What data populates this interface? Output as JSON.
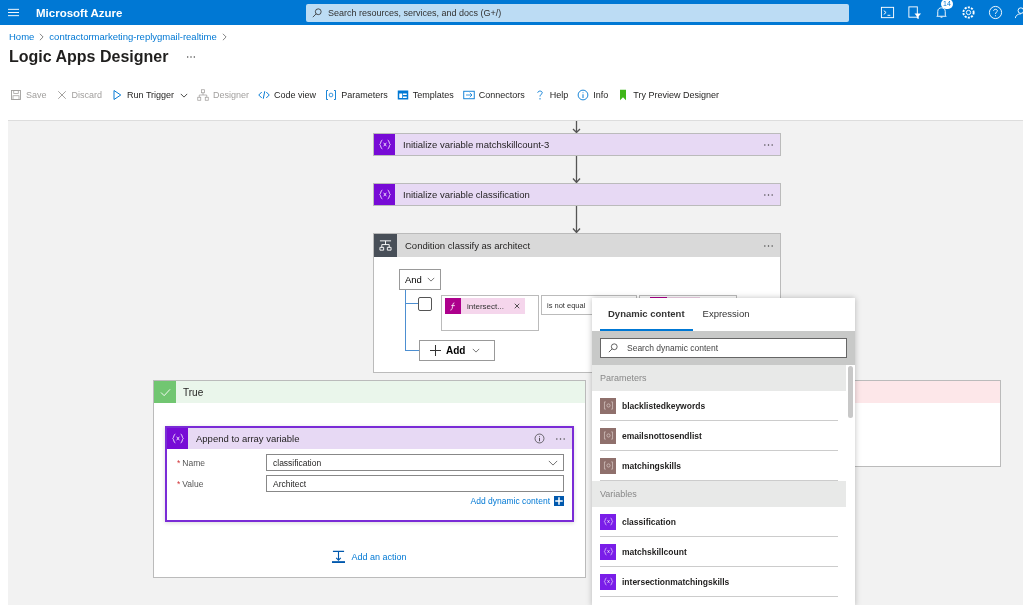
{
  "header": {
    "brand": "Microsoft Azure",
    "search_placeholder": "Search resources, services, and docs (G+/)",
    "notification_count": "14"
  },
  "breadcrumb": [
    "Home",
    "contractormarketing-replygmail-realtime"
  ],
  "page_title": "Logic Apps Designer",
  "toolbar": [
    {
      "label": "Save",
      "disabled": true,
      "dropdown": false
    },
    {
      "label": "Discard",
      "disabled": true,
      "dropdown": false
    },
    {
      "label": "Run Trigger",
      "disabled": false,
      "dropdown": true
    },
    {
      "label": "Designer",
      "disabled": true,
      "dropdown": false
    },
    {
      "label": "Code view",
      "disabled": false,
      "dropdown": false
    },
    {
      "label": "Parameters",
      "disabled": false,
      "dropdown": false
    },
    {
      "label": "Templates",
      "disabled": false,
      "dropdown": false
    },
    {
      "label": "Connectors",
      "disabled": false,
      "dropdown": false
    },
    {
      "label": "Help",
      "disabled": false,
      "dropdown": false
    },
    {
      "label": "Info",
      "disabled": false,
      "dropdown": false
    },
    {
      "label": "Try Preview Designer",
      "disabled": false,
      "dropdown": false
    }
  ],
  "canvas": {
    "actions": [
      {
        "title": "Initialize variable matchskillcount-3"
      },
      {
        "title": "Initialize variable classification"
      }
    ],
    "condition": {
      "title": "Condition classify as architect",
      "group_operator": "And",
      "row": {
        "checked": false,
        "left_token": "intersect...",
        "operator": "is not equal"
      },
      "add_label": "Add"
    },
    "true_branch": {
      "title": "True",
      "card": {
        "title": "Append to array variable",
        "fields": [
          {
            "label": "Name",
            "required_mark": "*",
            "value": "classification",
            "dropdown": true
          },
          {
            "label": "Value",
            "required_mark": "*",
            "value": "Architect",
            "dropdown": false
          }
        ],
        "add_dynamic": "Add dynamic content"
      },
      "add_action": "Add an action"
    },
    "false_branch": {
      "shown": true
    }
  },
  "dynamic_popup": {
    "tabs": [
      {
        "label": "Dynamic content",
        "selected": true
      },
      {
        "label": "Expression",
        "selected": false
      }
    ],
    "search_placeholder": "Search dynamic content",
    "sections": [
      {
        "title": "Parameters",
        "items": [
          {
            "kind": "parameter",
            "name": "blacklistedkeywords"
          },
          {
            "kind": "parameter",
            "name": "emailsnottosendlist"
          },
          {
            "kind": "parameter",
            "name": "matchingskills"
          }
        ]
      },
      {
        "title": "Variables",
        "items": [
          {
            "kind": "variable",
            "name": "classification"
          },
          {
            "kind": "variable",
            "name": "matchskillcount"
          },
          {
            "kind": "variable",
            "name": "intersectionmatchingskills"
          }
        ]
      }
    ]
  }
}
